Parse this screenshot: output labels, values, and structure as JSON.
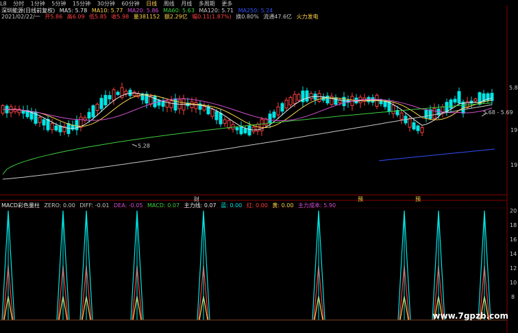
{
  "period_bar": {
    "items": [
      "1分钟",
      "5分钟",
      "15分钟",
      "30分钟",
      "60分钟",
      "日线",
      "周线",
      "月线",
      "多周期",
      "更多"
    ],
    "prefix": "L8",
    "partial": "分时",
    "selected": "日线"
  },
  "info_line": {
    "name": "深圳能源(日线前复权)",
    "ma5": "MA5: 5.78",
    "ma10": "MA10: 5.77",
    "ma20": "MA20: 5.86",
    "ma60": "MA60: 5.63",
    "ma120": "MA120: 5.71",
    "ma250": "MA250: 5.24"
  },
  "quote_line": {
    "date": "2021/02/22/一",
    "open": "开5.86",
    "high": "高6.09",
    "low": "低5.85",
    "close": "收5.98",
    "volume": "量381152",
    "amount": "额2.29亿",
    "change": "幅0.11(1.87%)",
    "turnover": "换0.80%",
    "float": "流通47.6亿",
    "concept": "火力发电"
  },
  "price_axis": {
    "top_label": "5.88",
    "mid_label": "19",
    "low_label": "19"
  },
  "annotations": {
    "low_price": "5.28",
    "range_label": "5.68 - 5.69"
  },
  "event_markers": [
    "财",
    "预",
    "预"
  ],
  "macd_line": {
    "title": "MACD彩色量柱",
    "zero": "ZERO: 0.00",
    "diff": "DIFF: -0.01",
    "dea": "DEA: -0.05",
    "macd": "MACD: 0.07",
    "main": "主力线: 0.07",
    "blue": "蓝: 0.00",
    "red": "红: 0.00",
    "yellow": "黄: 0.00",
    "cost": "主力成本: 5.90"
  },
  "macd_axis": [
    "20",
    "18",
    "16",
    "14",
    "12",
    "10",
    "8"
  ],
  "watermark": "www.7gpzb.com",
  "colors": {
    "up": "#ff4040",
    "down": "#00e5e5",
    "ma5": "#e8e8e8",
    "ma10": "#ffd24a",
    "ma20": "#d050d0",
    "ma60": "#40d040",
    "ma120": "#c8c8c8",
    "ma250": "#3050ff",
    "grid": "#8b0000"
  }
}
